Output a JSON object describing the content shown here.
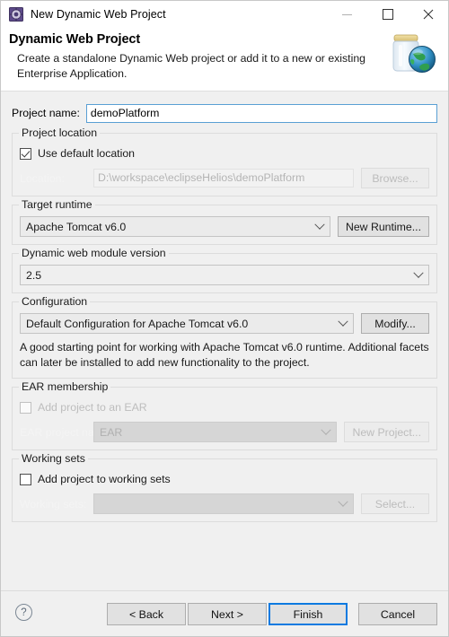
{
  "window": {
    "title": "New Dynamic Web Project",
    "icon": "eclipse-wizard-icon",
    "minimize_label": "—",
    "maximize_label": "□",
    "close_label": "✕"
  },
  "header": {
    "title": "Dynamic Web Project",
    "description": "Create a standalone Dynamic Web project or add it to a new or existing Enterprise Application.",
    "banner_icon": "jar-with-globe-icon"
  },
  "project_name": {
    "label": "Project name:",
    "value": "demoPlatform",
    "placeholder": ""
  },
  "project_location": {
    "legend": "Project location",
    "use_default_label": "Use default location",
    "use_default_checked": true,
    "location_label": "Location:",
    "location_value": "D:\\workspace\\eclipseHelios\\demoPlatform",
    "browse_label": "Browse..."
  },
  "target_runtime": {
    "legend": "Target runtime",
    "value": "Apache Tomcat v6.0",
    "new_runtime_label": "New Runtime..."
  },
  "module_version": {
    "legend": "Dynamic web module version",
    "value": "2.5"
  },
  "configuration": {
    "legend": "Configuration",
    "value": "Default Configuration for Apache Tomcat v6.0",
    "modify_label": "Modify...",
    "description": "A good starting point for working with Apache Tomcat v6.0 runtime. Additional facets can later be installed to add new functionality to the project."
  },
  "ear_membership": {
    "legend": "EAR membership",
    "add_to_ear_label": "Add project to an EAR",
    "add_to_ear_checked": false,
    "ear_project_name_label": "EAR project name:",
    "ear_project_name_value": "EAR",
    "new_project_label": "New Project..."
  },
  "working_sets": {
    "legend": "Working sets",
    "add_to_working_sets_label": "Add project to working sets",
    "add_to_working_sets_checked": false,
    "working_sets_label": "Working sets:",
    "working_sets_value": "",
    "select_label": "Select..."
  },
  "footer": {
    "help_label": "?",
    "back_label": "< Back",
    "next_label": "Next >",
    "finish_label": "Finish",
    "cancel_label": "Cancel"
  },
  "colors": {
    "dialog_bg": "#f0f0f0",
    "header_bg": "#ffffff",
    "focus_border": "#0d7ae0",
    "input_border": "#5a9fd4",
    "disabled_text": "#bdbdbd"
  }
}
